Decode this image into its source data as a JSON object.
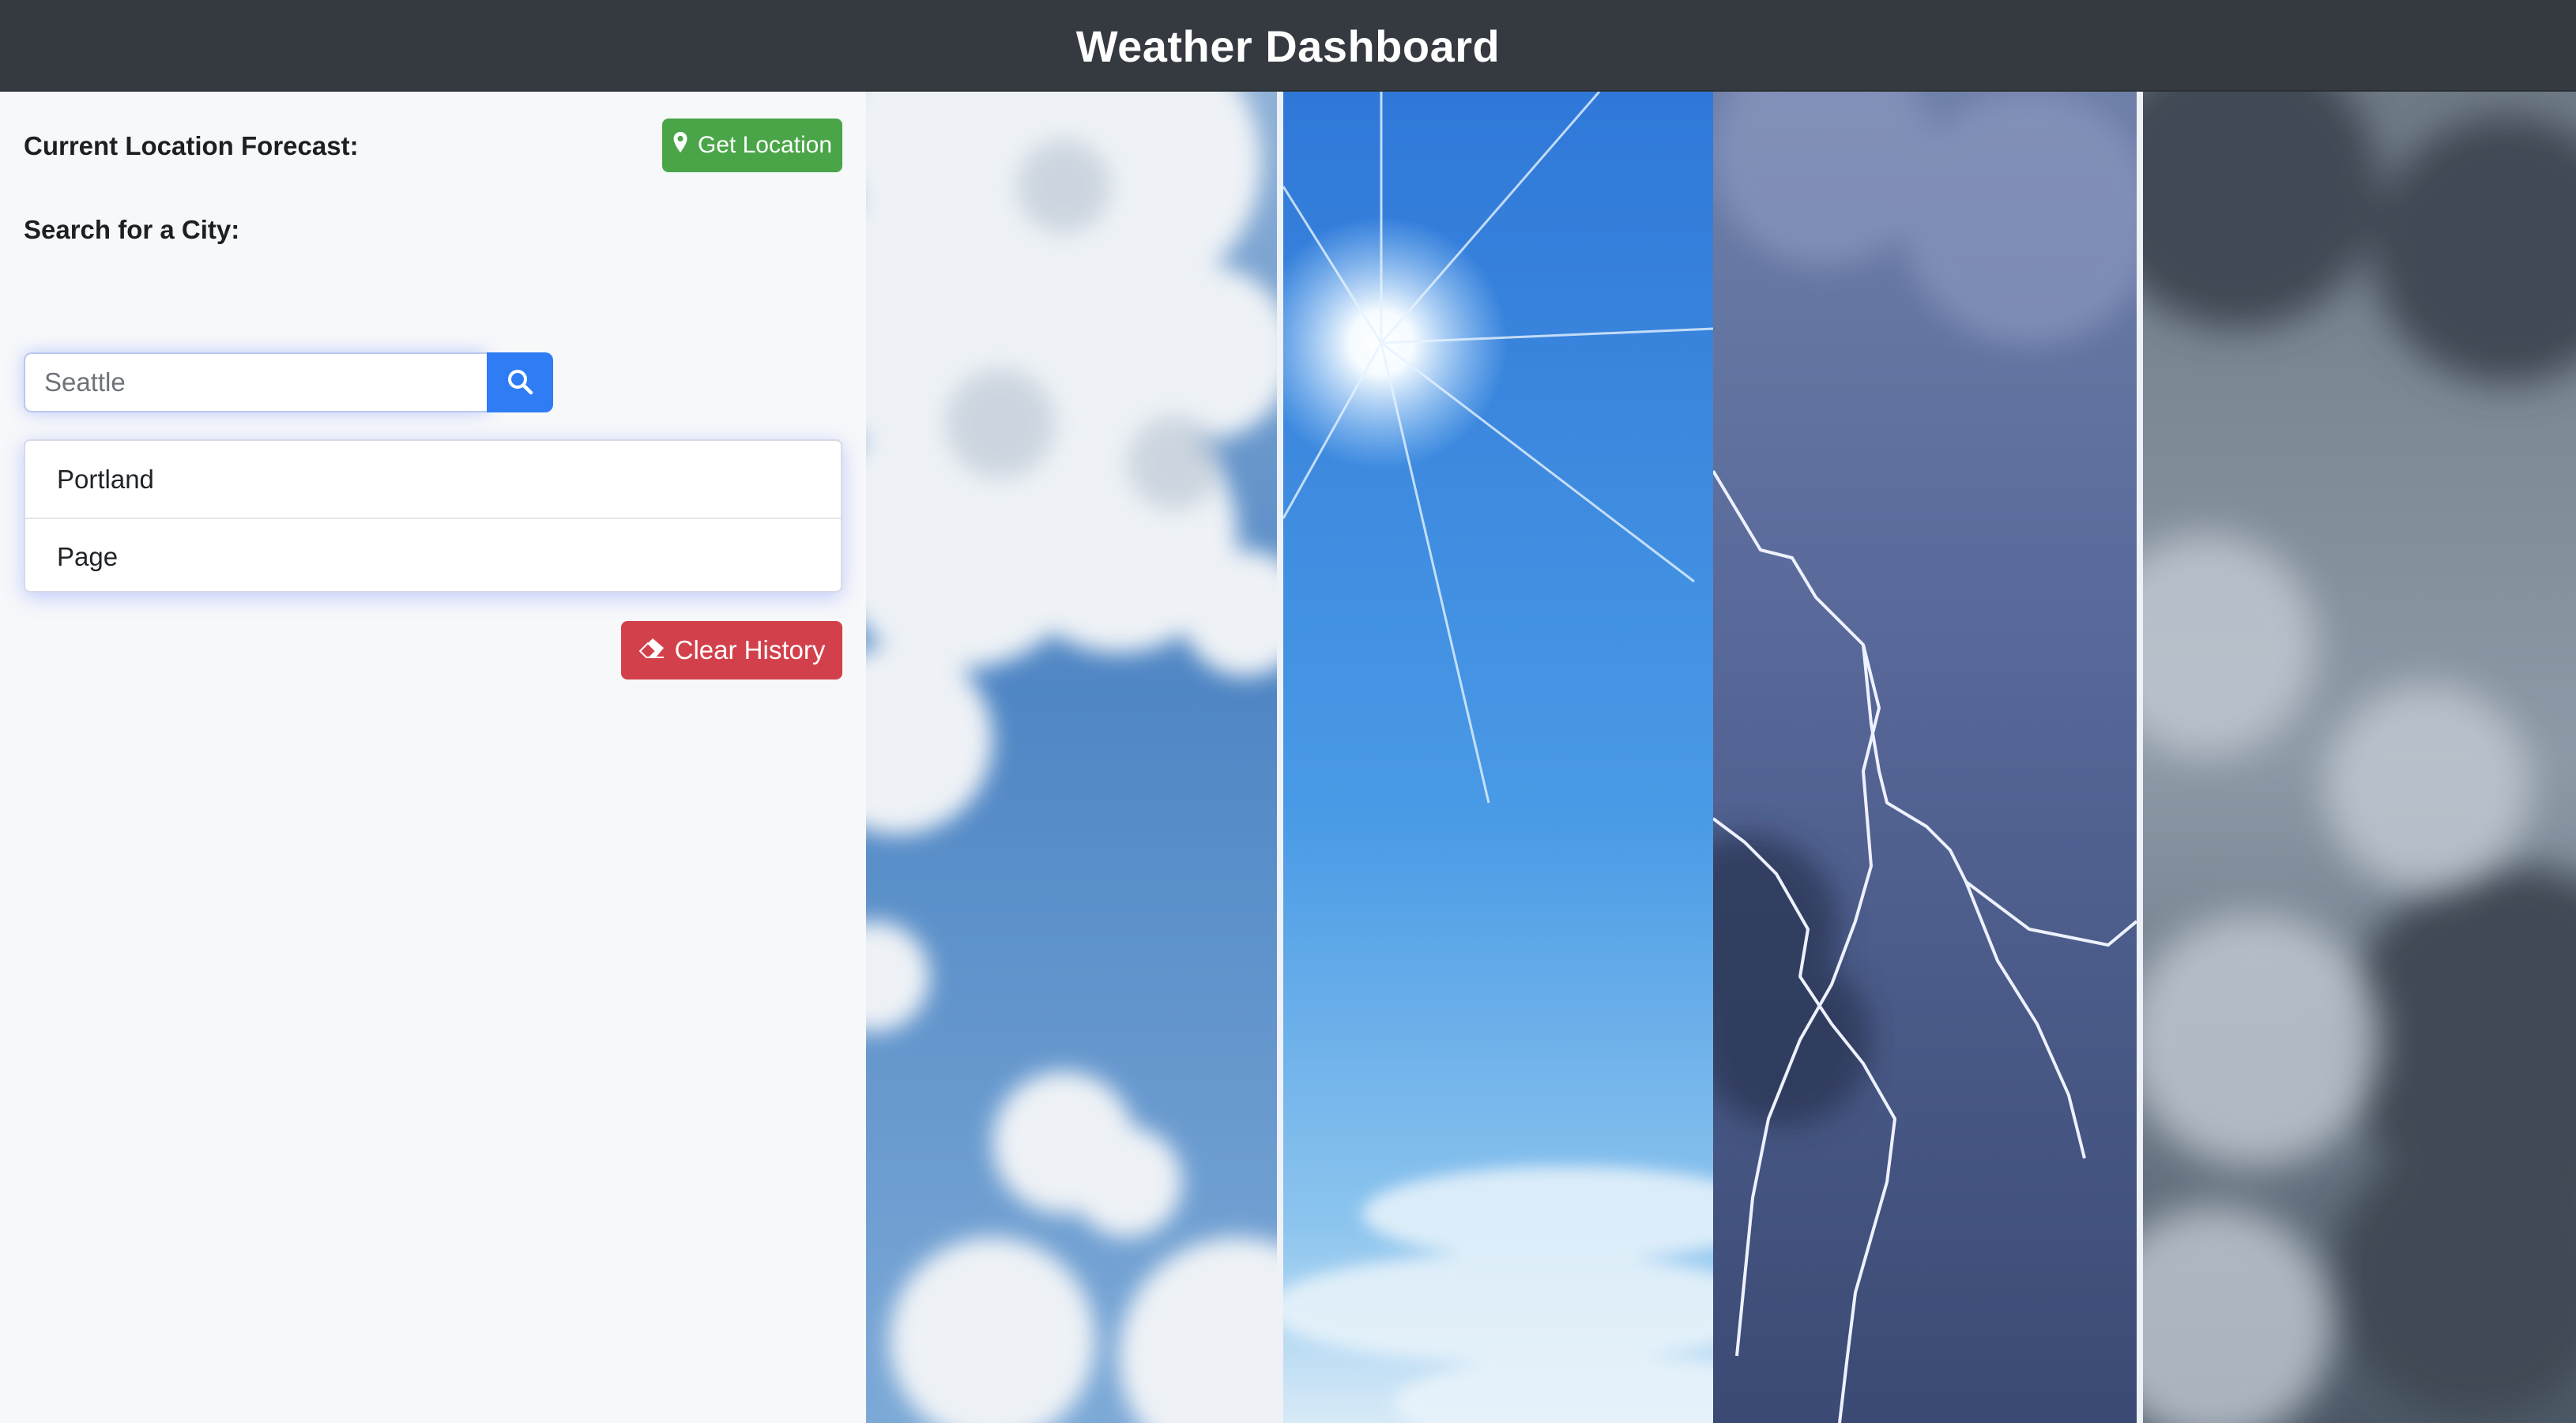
{
  "header": {
    "title": "Weather Dashboard"
  },
  "sidebar": {
    "current_location_label": "Current Location Forecast:",
    "get_location_label": "Get Location",
    "search_label": "Search for a City:",
    "search_placeholder": "Seattle",
    "history": [
      {
        "label": "Portland"
      },
      {
        "label": "Page"
      }
    ],
    "clear_history_label": "Clear History"
  },
  "panels": [
    {
      "name": "clouds"
    },
    {
      "name": "sunny"
    },
    {
      "name": "lightning"
    },
    {
      "name": "storm-clouds"
    }
  ],
  "colors": {
    "topbar": "#343a40",
    "get_location": "#4aa548",
    "search_button": "#2f7cf5",
    "clear_history": "#d2404b",
    "sidebar_bg": "#f7f8fa"
  },
  "icons": [
    "map-marker-icon",
    "search-icon",
    "eraser-icon"
  ]
}
